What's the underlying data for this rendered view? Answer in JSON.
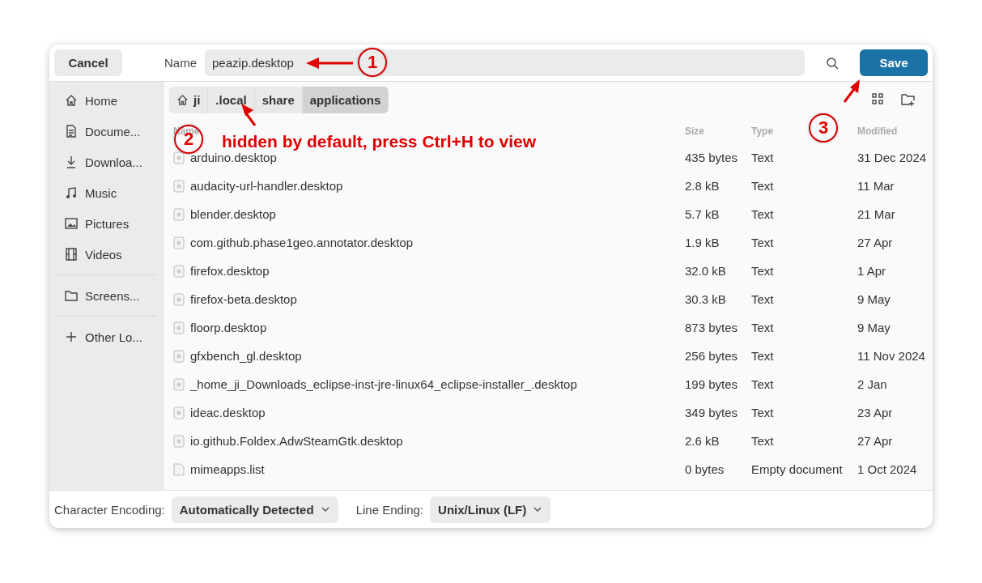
{
  "header": {
    "cancel": "Cancel",
    "name_label": "Name",
    "name_value": "peazip.desktop",
    "save": "Save"
  },
  "sidebar": {
    "items": [
      {
        "kind": "place",
        "label": "Home"
      },
      {
        "kind": "place",
        "label": "Docume..."
      },
      {
        "kind": "place",
        "label": "Downloa..."
      },
      {
        "kind": "place",
        "label": "Music"
      },
      {
        "kind": "place",
        "label": "Pictures"
      },
      {
        "kind": "place",
        "label": "Videos"
      },
      {
        "kind": "separator"
      },
      {
        "kind": "place",
        "label": "Screens..."
      },
      {
        "kind": "separator"
      },
      {
        "kind": "place",
        "label": "Other Lo..."
      }
    ]
  },
  "path": [
    {
      "label": "ji",
      "selected": false
    },
    {
      "label": ".local",
      "selected": false
    },
    {
      "label": "share",
      "selected": false
    },
    {
      "label": "applications",
      "selected": true
    }
  ],
  "table": {
    "columns": [
      "Name",
      "Size",
      "Type",
      "Modified"
    ],
    "rows": [
      {
        "kind": "desktop",
        "cells": [
          "arduino.desktop",
          "435 bytes",
          "Text",
          "31 Dec 2024"
        ]
      },
      {
        "kind": "desktop",
        "cells": [
          "audacity-url-handler.desktop",
          "2.8 kB",
          "Text",
          "11 Mar"
        ]
      },
      {
        "kind": "desktop",
        "cells": [
          "blender.desktop",
          "5.7 kB",
          "Text",
          "21 Mar"
        ]
      },
      {
        "kind": "desktop",
        "cells": [
          "com.github.phase1geo.annotator.desktop",
          "1.9 kB",
          "Text",
          "27 Apr"
        ]
      },
      {
        "kind": "desktop",
        "cells": [
          "firefox.desktop",
          "32.0 kB",
          "Text",
          "1 Apr"
        ]
      },
      {
        "kind": "desktop",
        "cells": [
          "firefox-beta.desktop",
          "30.3 kB",
          "Text",
          "9 May"
        ]
      },
      {
        "kind": "desktop",
        "cells": [
          "floorp.desktop",
          "873 bytes",
          "Text",
          "9 May"
        ]
      },
      {
        "kind": "desktop",
        "cells": [
          "gfxbench_gl.desktop",
          "256 bytes",
          "Text",
          "11 Nov 2024"
        ]
      },
      {
        "kind": "desktop",
        "cells": [
          "_home_ji_Downloads_eclipse-inst-jre-linux64_eclipse-installer_.desktop",
          "199 bytes",
          "Text",
          "2 Jan"
        ]
      },
      {
        "kind": "desktop",
        "cells": [
          "ideac.desktop",
          "349 bytes",
          "Text",
          "23 Apr"
        ]
      },
      {
        "kind": "desktop",
        "cells": [
          "io.github.Foldex.AdwSteamGtk.desktop",
          "2.6 kB",
          "Text",
          "27 Apr"
        ]
      },
      {
        "kind": "plain",
        "cells": [
          "mimeapps.list",
          "0 bytes",
          "Empty document",
          "1 Oct 2024"
        ]
      }
    ]
  },
  "footer": {
    "encoding_label": "Character Encoding:",
    "encoding_value": "Automatically Detected",
    "line_label": "Line Ending:",
    "line_value": "Unix/Linux (LF)"
  },
  "annotations": {
    "markers": [
      "1",
      "2",
      "3"
    ],
    "note": "hidden by default, press Ctrl+H to view"
  }
}
